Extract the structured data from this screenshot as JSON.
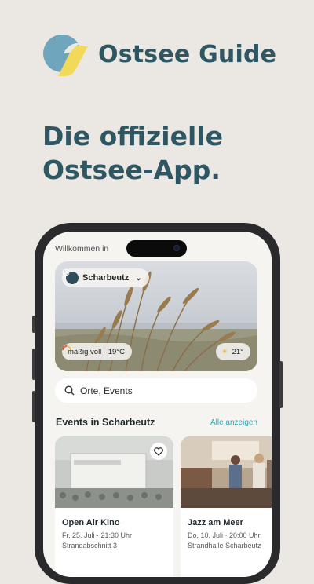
{
  "brand": {
    "name": "Ostsee Guide",
    "logo_icon": "ostsee-logo-icon"
  },
  "headline": {
    "line1": "Die offizielle",
    "line2": "Ostsee-App."
  },
  "app": {
    "welcome": "Willkommen in",
    "location": {
      "name": "Scharbeutz",
      "icon": "location-badge-icon"
    },
    "status": {
      "crowd": "mäßig voll · 19°C",
      "weather": "21°"
    },
    "search": {
      "placeholder": "Orte, Events"
    },
    "events": {
      "title": "Events in Scharbeutz",
      "see_all": "Alle anzeigen",
      "items": [
        {
          "title": "Open Air Kino",
          "date": "Fr, 25. Juli · 21:30 Uhr",
          "place": "Strandabschnitt 3"
        },
        {
          "title": "Jazz am Meer",
          "date": "Do, 10. Juli · 20:00 Uhr",
          "place": "Strandhalle Scharbeutz"
        }
      ]
    }
  },
  "colors": {
    "background": "#ebe8e3",
    "brand_text": "#2f5663",
    "logo_blue": "#6fa6bd",
    "logo_yellow": "#f1d95a",
    "accent_link": "#2aa9b4",
    "phone_frame": "#2a2a2c"
  }
}
